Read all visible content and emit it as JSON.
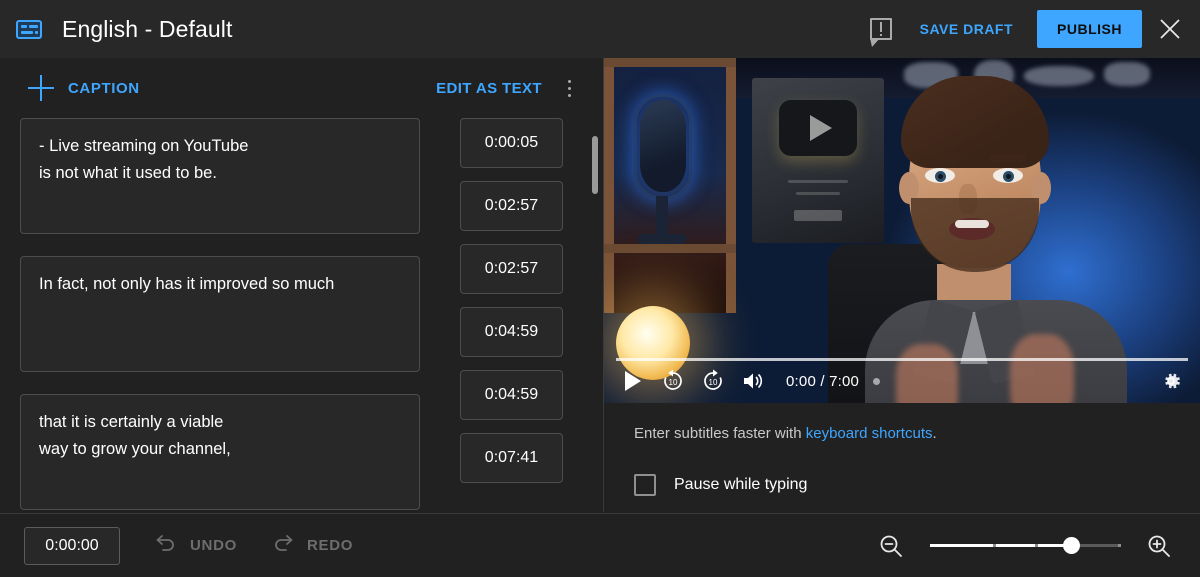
{
  "header": {
    "icon": "subtitles-icon",
    "title": "English - Default",
    "feedback_icon": "feedback-icon",
    "save_draft_label": "SAVE DRAFT",
    "publish_label": "PUBLISH",
    "close_icon": "close-icon",
    "accent_color": "#3ea6ff",
    "bg_color": "#282828"
  },
  "caption_toolbar": {
    "add_icon": "plus-icon",
    "add_label": "CAPTION",
    "edit_as_text_label": "EDIT AS TEXT",
    "more_icon": "more-vert-icon"
  },
  "captions": [
    {
      "lines": [
        "- Live streaming on YouTube",
        "is not what it used to be."
      ],
      "time": "0:00:05"
    },
    {
      "lines": [
        "In fact, not only has it improved so much"
      ],
      "time": "0:02:57"
    },
    {
      "lines": [
        "that it is certainly a viable",
        "way to grow your channel,"
      ],
      "time": "0:02:57"
    }
  ],
  "timestamps": [
    "0:00:05",
    "0:02:57",
    "0:02:57",
    "0:04:59",
    "0:04:59",
    "0:07:41"
  ],
  "player": {
    "play_icon": "play-icon",
    "rewind_icon": "replay-10-icon",
    "forward_icon": "forward-10-icon",
    "volume_icon": "volume-icon",
    "time_display": "0:00 / 7:00",
    "current_time": "0:00",
    "duration": "7:00",
    "settings_icon": "gear-icon",
    "progress_percent": 0
  },
  "hints": {
    "text_before": "Enter subtitles faster with ",
    "link_label": "keyboard shortcuts",
    "text_after": ".",
    "pause_checkbox_label": "Pause while typing",
    "pause_checked": false
  },
  "bottom_bar": {
    "time_value": "0:00:00",
    "undo_icon": "undo-icon",
    "undo_label": "UNDO",
    "redo_icon": "redo-icon",
    "redo_label": "REDO",
    "zoom_out_icon": "zoom-out-icon",
    "zoom_in_icon": "zoom-in-icon",
    "zoom_level_percent": 74
  }
}
